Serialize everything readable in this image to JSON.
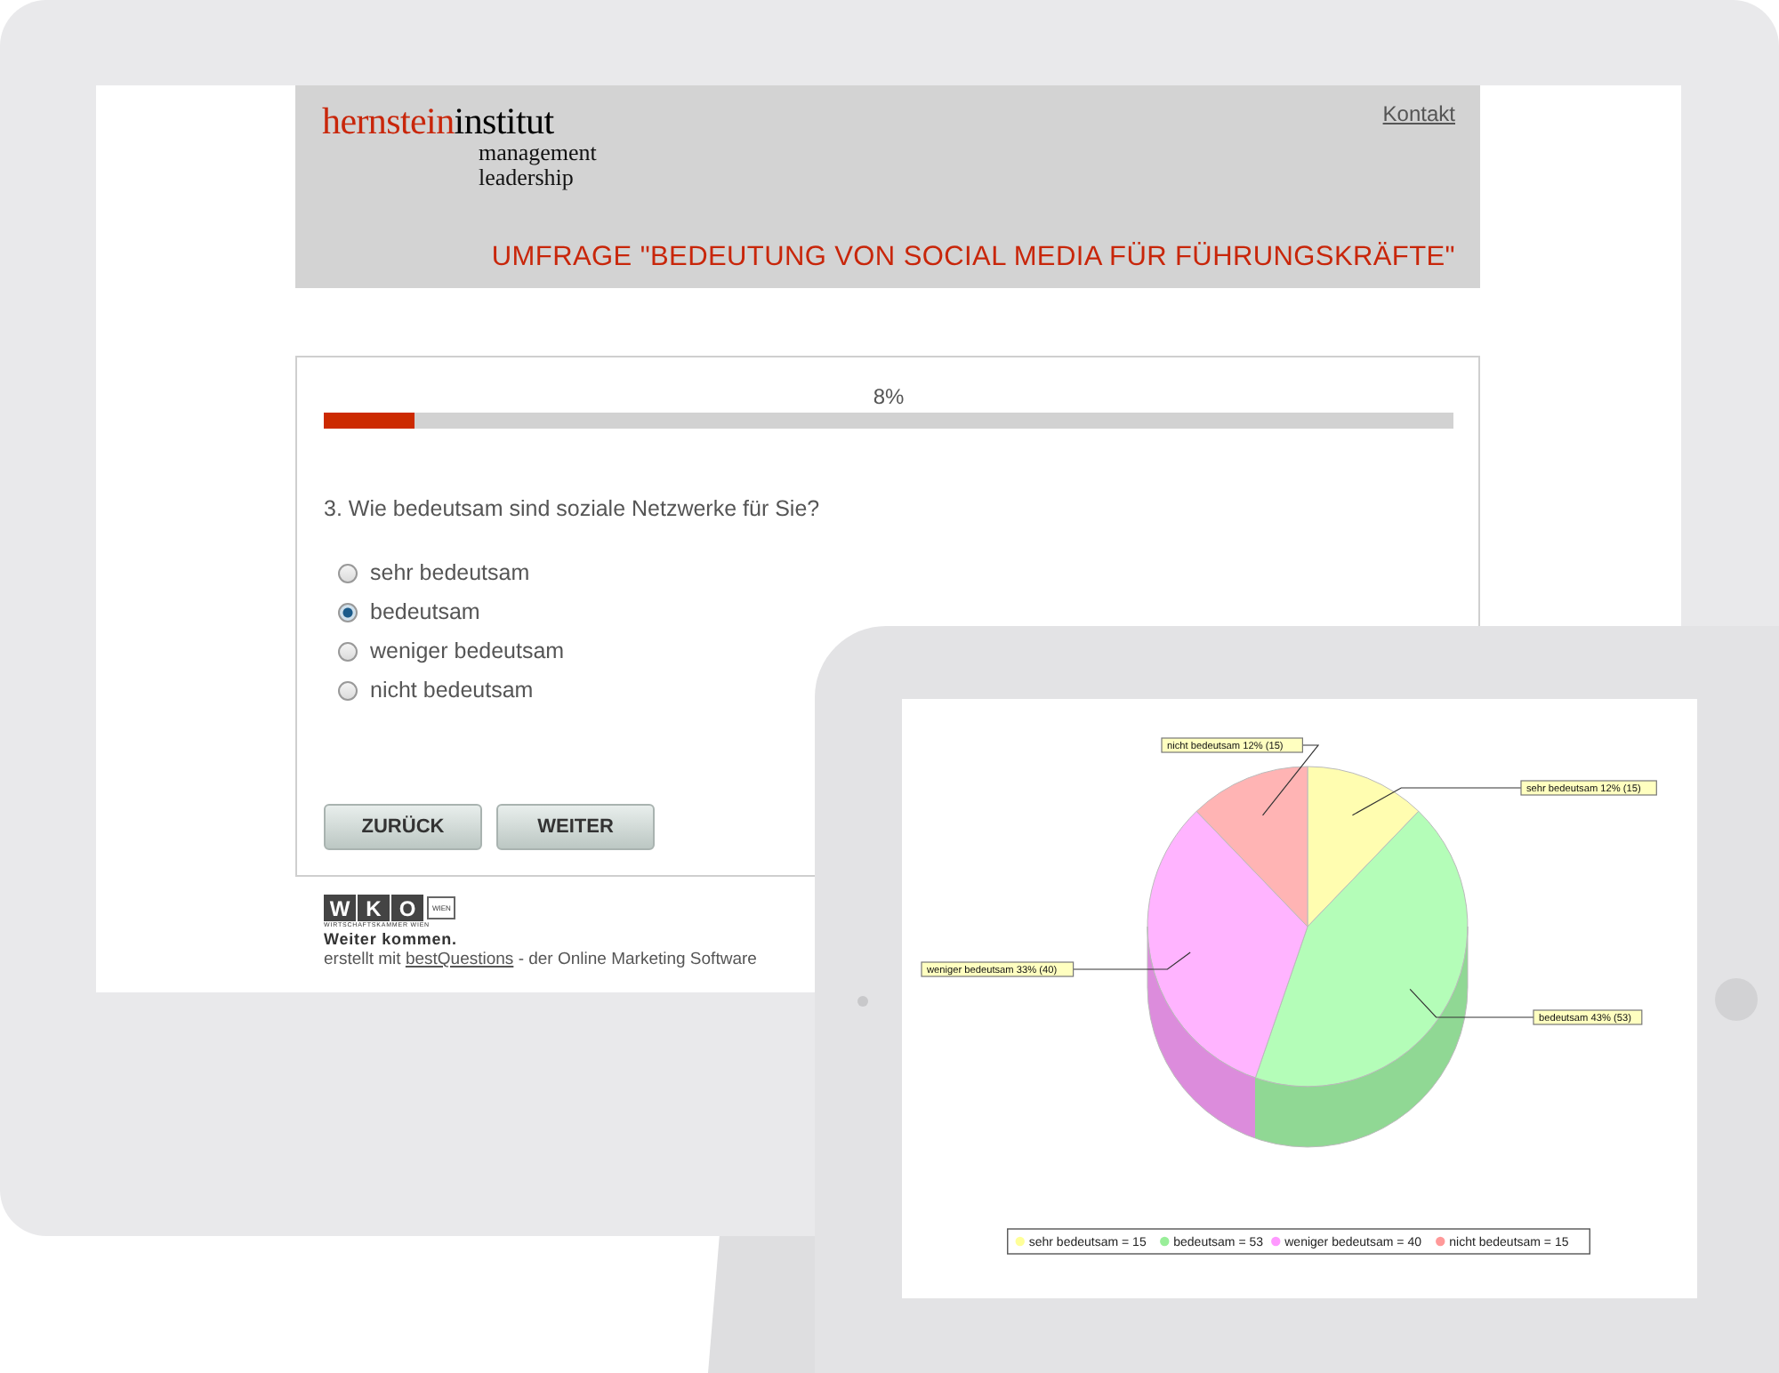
{
  "header": {
    "logo": {
      "brand_red": "hernstein",
      "brand_black": "institut",
      "line_1": "management",
      "line_2": "leadership"
    },
    "contact_link": "Kontakt",
    "title": "UMFRAGE \"BEDEUTUNG VON SOCIAL MEDIA FÜR FÜHRUNGSKRÄFTE\""
  },
  "progress": {
    "label": "8%",
    "level": 0.08
  },
  "question": "3. Wie bedeutsam sind soziale Netzwerke für Sie?",
  "options": [
    {
      "label": "sehr bedeutsam",
      "selected": false
    },
    {
      "label": "bedeutsam",
      "selected": true
    },
    {
      "label": "weniger bedeutsam",
      "selected": false
    },
    {
      "label": "nicht bedeutsam",
      "selected": false
    }
  ],
  "buttons": [
    "ZURÜCK",
    "WEITER"
  ],
  "footer": {
    "logo": {
      "letters": [
        "W",
        "K",
        "O"
      ],
      "region": "WIEN",
      "org": "WIRTSCHAFTSKAMMER WIEN"
    },
    "slogan": "Weiter kommen.",
    "credit_prefix": "erstellt mit",
    "credit_link": "bestQuestions",
    "credit_suffix": "- der Online Marketing Software"
  },
  "tablet_chart": {
    "chart_data": {
      "type": "pie",
      "values": [
        15,
        53,
        40,
        15
      ],
      "value_labels": [
        "sehr bedeutsam 12% (15)",
        "bedeutsam 43% (53)",
        "weniger bedeutsam 33% (40)",
        "nicht bedeutsam 12% (15)"
      ]
    },
    "legend": [
      {
        "label": "sehr bedeutsam = 15",
        "color": "#ffff99"
      },
      {
        "label": "bedeutsam = 53",
        "color": "#99ee99"
      },
      {
        "label": "weniger bedeutsam = 40",
        "color": "#ff99ff"
      },
      {
        "label": "nicht bedeutsam = 15",
        "color": "#ff9999"
      }
    ]
  }
}
